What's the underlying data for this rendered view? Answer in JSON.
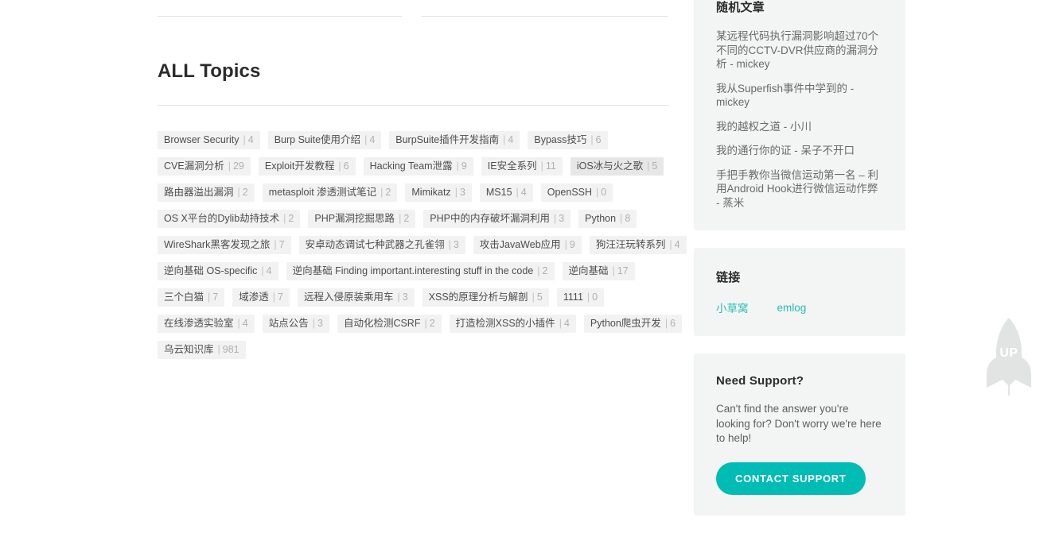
{
  "main": {
    "title": "ALL Topics",
    "tag_rows": [
      [
        {
          "label": "Browser Security",
          "count": "4",
          "active": false
        },
        {
          "label": "Burp Suite使用介绍",
          "count": "4",
          "active": false
        },
        {
          "label": "BurpSuite插件开发指南",
          "count": "4",
          "active": false
        },
        {
          "label": "Bypass技巧",
          "count": "6",
          "active": false
        }
      ],
      [
        {
          "label": "CVE漏洞分析",
          "count": "29",
          "active": false
        },
        {
          "label": "Exploit开发教程",
          "count": "6",
          "active": false
        },
        {
          "label": "Hacking Team泄露",
          "count": "9",
          "active": false
        },
        {
          "label": "IE安全系列",
          "count": "11",
          "active": false
        },
        {
          "label": "iOS冰与火之歌",
          "count": "5",
          "active": true
        }
      ],
      [
        {
          "label": "路由器溢出漏洞",
          "count": "2",
          "active": false
        },
        {
          "label": "metasploit 渗透测试笔记",
          "count": "2",
          "active": false
        },
        {
          "label": "Mimikatz",
          "count": "3",
          "active": false
        },
        {
          "label": "MS15",
          "count": "4",
          "active": false
        },
        {
          "label": "OpenSSH",
          "count": "0",
          "active": false
        }
      ],
      [
        {
          "label": "OS X平台的Dylib劫持技术",
          "count": "2",
          "active": false
        },
        {
          "label": "PHP漏洞挖掘思路",
          "count": "2",
          "active": false
        },
        {
          "label": "PHP中的内存破坏漏洞利用",
          "count": "3",
          "active": false
        },
        {
          "label": "Python",
          "count": "8",
          "active": false
        }
      ],
      [
        {
          "label": "WireShark黑客发现之旅",
          "count": "7",
          "active": false
        },
        {
          "label": "安卓动态调试七种武器之孔雀翎",
          "count": "3",
          "active": false
        },
        {
          "label": "攻击JavaWeb应用",
          "count": "9",
          "active": false
        },
        {
          "label": "狗汪汪玩转系列",
          "count": "4",
          "active": false
        }
      ],
      [
        {
          "label": "逆向基础 OS-specific",
          "count": "4",
          "active": false
        },
        {
          "label": "逆向基础 Finding important.interesting stuff in the code",
          "count": "2",
          "active": false
        },
        {
          "label": "逆向基础",
          "count": "17",
          "active": false
        }
      ],
      [
        {
          "label": "三个白猫",
          "count": "7",
          "active": false
        },
        {
          "label": "域渗透",
          "count": "7",
          "active": false
        },
        {
          "label": "远程入侵原装乘用车",
          "count": "3",
          "active": false
        },
        {
          "label": "XSS的原理分析与解剖",
          "count": "5",
          "active": false
        },
        {
          "label": "1111",
          "count": "0",
          "active": false
        }
      ],
      [
        {
          "label": "在线渗透实验室",
          "count": "4",
          "active": false
        },
        {
          "label": "站点公告",
          "count": "3",
          "active": false
        },
        {
          "label": "自动化检测CSRF",
          "count": "2",
          "active": false
        },
        {
          "label": "打造检测XSS的小插件",
          "count": "4",
          "active": false
        },
        {
          "label": "Python爬虫开发",
          "count": "6",
          "active": false
        }
      ],
      [
        {
          "label": "乌云知识库",
          "count": "981",
          "active": false
        }
      ]
    ]
  },
  "sidebar": {
    "random_articles": {
      "title": "随机文章",
      "items": [
        "某远程代码执行漏洞影响超过70个不同的CCTV-DVR供应商的漏洞分析 - mickey",
        "我从Superfish事件中学到的 - mickey",
        "我的越权之道 - 小川",
        "我的通行你的证 - 呆子不开口",
        "手把手教你当微信运动第一名 – 利用Android Hook进行微信运动作弊 - 蒸米"
      ]
    },
    "links": {
      "title": "链接",
      "items": [
        "小草窝",
        "emlog"
      ]
    },
    "support": {
      "title": "Need Support?",
      "text": "Can't find the answer you're looking for? Don't worry we're here to help!",
      "button_label": "CONTACT SUPPORT"
    }
  },
  "scroll_top": {
    "label": "UP"
  },
  "colors": {
    "accent_teal": "#00bcb4",
    "link_teal": "#27bdb5",
    "chip_bg": "#f2f2f2",
    "chip_bg_active": "#e7e7e7",
    "card_bg": "#f3f4f4",
    "rocket_gray": "#e2e4e4"
  }
}
